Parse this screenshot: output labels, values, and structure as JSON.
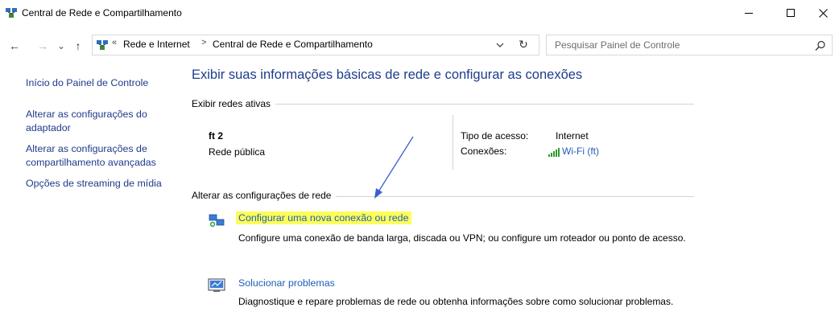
{
  "window": {
    "title": "Central de Rede e Compartilhamento",
    "minimize": "—",
    "maximize": "☐",
    "close": "✕"
  },
  "nav": {
    "back": "←",
    "forward": "→",
    "recent": "⌄",
    "up": "↑"
  },
  "address": {
    "overflow": "«",
    "crumbs": [
      "Rede e Internet",
      "Central de Rede e Compartilhamento"
    ],
    "separator": ">",
    "refresh": "↻"
  },
  "search": {
    "placeholder": "Pesquisar Painel de Controle"
  },
  "sidebar": {
    "items": [
      {
        "label": "Início do Painel de Controle"
      },
      {
        "label": "Alterar as configurações do adaptador"
      },
      {
        "label": "Alterar as configurações de compartilhamento avançadas"
      },
      {
        "label": "Opções de streaming de mídia"
      }
    ]
  },
  "main": {
    "heading": "Exibir suas informações básicas de rede e configurar as conexões",
    "active_networks": {
      "label": "Exibir redes ativas",
      "network_name": "ft 2",
      "network_profile": "Rede pública",
      "access_type_label": "Tipo de acesso:",
      "access_type_value": "Internet",
      "connections_label": "Conexões:",
      "connection_link": "Wi-Fi (ft)"
    },
    "change_settings": {
      "label": "Alterar as configurações de rede",
      "tasks": [
        {
          "title": "Configurar uma nova conexão ou rede",
          "description": "Configure uma conexão de banda larga, discada ou VPN; ou configure um roteador ou ponto de acesso.",
          "highlighted": true
        },
        {
          "title": "Solucionar problemas",
          "description": "Diagnostique e repare problemas de rede ou obtenha informações sobre como solucionar problemas.",
          "highlighted": false
        }
      ]
    }
  },
  "colors": {
    "link": "#1f5fb8",
    "heading": "#1e3c8c",
    "highlight": "#fdfd5a",
    "annotation_arrow": "#3a5fcd"
  }
}
